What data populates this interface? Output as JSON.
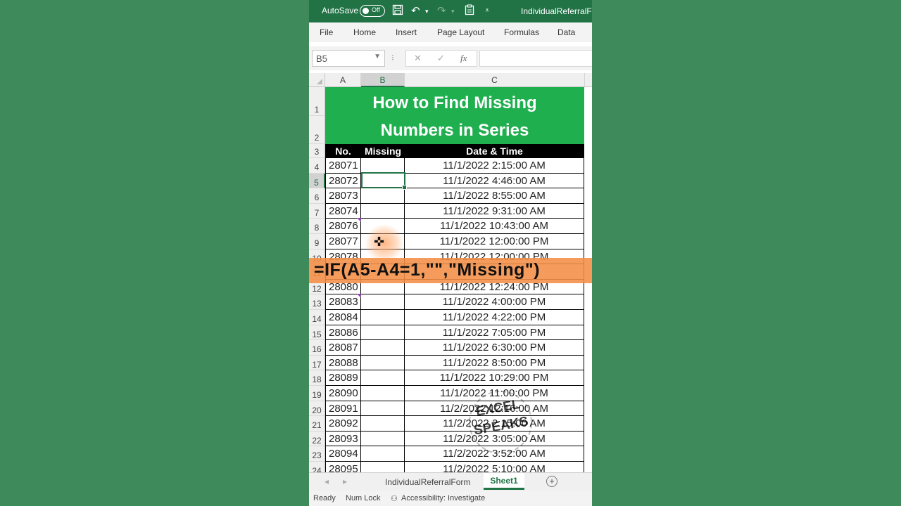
{
  "titlebar": {
    "autosave_label": "AutoSave",
    "toggle_state": "Off",
    "doc_name": "IndividualReferralForm"
  },
  "ribbon_tabs": [
    "File",
    "Home",
    "Insert",
    "Page Layout",
    "Formulas",
    "Data"
  ],
  "formula_bar": {
    "name_box": "B5",
    "cancel_icon": "✕",
    "enter_icon": "✓",
    "fx_label": "fx",
    "formula": ""
  },
  "columns": [
    "A",
    "B",
    "C"
  ],
  "row_numbers": [
    "1",
    "2",
    "3",
    "4",
    "5",
    "6",
    "7",
    "8",
    "9",
    "10",
    "11",
    "12",
    "13",
    "14",
    "15",
    "16",
    "17",
    "18",
    "19",
    "20",
    "21",
    "22",
    "23",
    "24"
  ],
  "sheet_title": {
    "line1": "How to Find Missing",
    "line2": "Numbers in Series"
  },
  "table_headers": {
    "no": "No.",
    "missing": "Missing",
    "datetime": "Date & Time"
  },
  "rows": [
    {
      "no": "28071",
      "missing": "",
      "datetime": "11/1/2022 2:15:00 AM"
    },
    {
      "no": "28072",
      "missing": "",
      "datetime": "11/1/2022 4:46:00 AM"
    },
    {
      "no": "28073",
      "missing": "",
      "datetime": "11/1/2022 8:55:00 AM"
    },
    {
      "no": "28074",
      "missing": "",
      "datetime": "11/1/2022 9:31:00 AM"
    },
    {
      "no": "28076",
      "missing": "",
      "datetime": "11/1/2022 10:43:00 AM"
    },
    {
      "no": "28077",
      "missing": "",
      "datetime": "11/1/2022 12:00:00 PM"
    },
    {
      "no": "28078",
      "missing": "",
      "datetime": "11/1/2022 12:00:00 PM"
    },
    {
      "no": "",
      "missing": "",
      "datetime": ""
    },
    {
      "no": "28080",
      "missing": "",
      "datetime": "11/1/2022 12:24:00 PM"
    },
    {
      "no": "28083",
      "missing": "",
      "datetime": "11/1/2022 4:00:00 PM"
    },
    {
      "no": "28084",
      "missing": "",
      "datetime": "11/1/2022 4:22:00 PM"
    },
    {
      "no": "28086",
      "missing": "",
      "datetime": "11/1/2022 7:05:00 PM"
    },
    {
      "no": "28087",
      "missing": "",
      "datetime": "11/1/2022 6:30:00 PM"
    },
    {
      "no": "28088",
      "missing": "",
      "datetime": "11/1/2022 8:50:00 PM"
    },
    {
      "no": "28089",
      "missing": "",
      "datetime": "11/1/2022 10:29:00 PM"
    },
    {
      "no": "28090",
      "missing": "",
      "datetime": "11/1/2022 11:00:00 PM"
    },
    {
      "no": "28091",
      "missing": "",
      "datetime": "11/2/2022 12:16:00 AM"
    },
    {
      "no": "28092",
      "missing": "",
      "datetime": "11/2/2022 2:15:00 AM"
    },
    {
      "no": "28093",
      "missing": "",
      "datetime": "11/2/2022 3:05:00 AM"
    },
    {
      "no": "28094",
      "missing": "",
      "datetime": "11/2/2022 3:52:00 AM"
    },
    {
      "no": "28095",
      "missing": "",
      "datetime": "11/2/2022 5:10:00 AM"
    }
  ],
  "overlay_formula": "=IF(A5-A4=1,\"\",\"Missing\")",
  "watermark": {
    "line1": "EXCEL",
    "line2": "SPEAKS"
  },
  "sheet_tabs": [
    "IndividualReferralForm",
    "Sheet1"
  ],
  "active_sheet": "Sheet1",
  "status": {
    "ready": "Ready",
    "numlock": "Num Lock",
    "accessibility": "Accessibility: Investigate"
  },
  "colors": {
    "excel_green": "#217346",
    "title_fill": "#1faf4f",
    "header_fill": "#000000",
    "formula_band": "#f48e46",
    "background": "#3f8a5a"
  }
}
